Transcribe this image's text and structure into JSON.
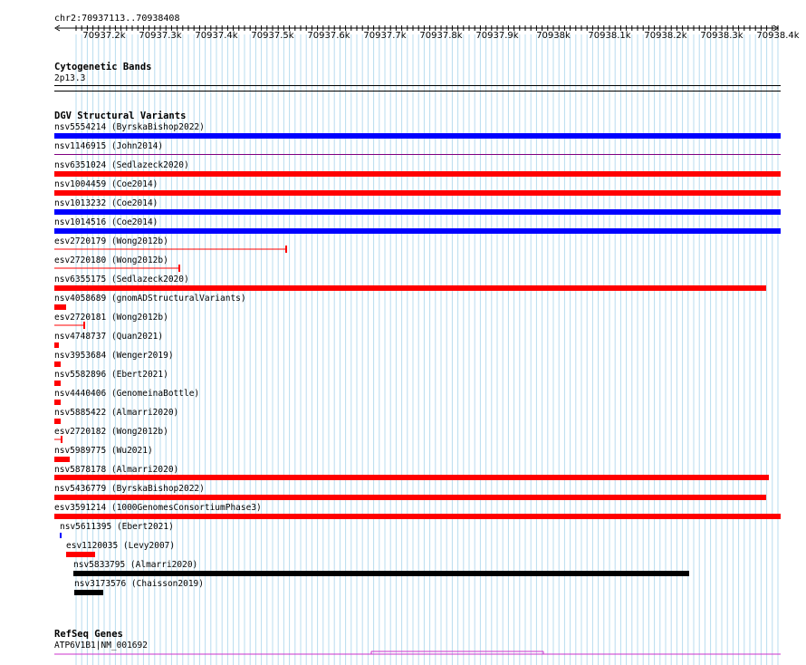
{
  "ruler": {
    "region": "chr2:70937113..70938408",
    "ticks": [
      "70937.2k",
      "70937.3k",
      "70937.4k",
      "70937.5k",
      "70937.6k",
      "70937.7k",
      "70937.8k",
      "70937.9k",
      "70938k",
      "70938.1k",
      "70938.2k",
      "70938.3k",
      "70938.4k"
    ]
  },
  "cytobands": {
    "title": "Cytogenetic Bands",
    "band": "2p13.3"
  },
  "dgv": {
    "title": "DGV Structural Variants",
    "features": [
      {
        "label": "nsv5554214 (ByrskaBishop2022)",
        "color": "#0000ff"
      },
      {
        "label": "nsv1146915 (John2014)",
        "color": "#800080"
      },
      {
        "label": "nsv6351024 (Sedlazeck2020)",
        "color": "#ff0000"
      },
      {
        "label": "nsv1004459 (Coe2014)",
        "color": "#ff0000"
      },
      {
        "label": "nsv1013232 (Coe2014)",
        "color": "#0000ff"
      },
      {
        "label": "nsv1014516 (Coe2014)",
        "color": "#0000ff"
      },
      {
        "label": "esv2720179 (Wong2012b)",
        "color": "#ff0000"
      },
      {
        "label": "esv2720180 (Wong2012b)",
        "color": "#ff0000"
      },
      {
        "label": "nsv6355175 (Sedlazeck2020)",
        "color": "#ff0000"
      },
      {
        "label": "nsv4058689 (gnomADStructuralVariants)",
        "color": "#ff0000"
      },
      {
        "label": "esv2720181 (Wong2012b)",
        "color": "#ff0000"
      },
      {
        "label": "nsv4748737 (Quan2021)",
        "color": "#ff0000"
      },
      {
        "label": "nsv3953684 (Wenger2019)",
        "color": "#ff0000"
      },
      {
        "label": "nsv5582896 (Ebert2021)",
        "color": "#ff0000"
      },
      {
        "label": "nsv4440406 (GenomeinaBottle)",
        "color": "#ff0000"
      },
      {
        "label": "nsv5885422 (Almarri2020)",
        "color": "#ff0000"
      },
      {
        "label": "esv2720182 (Wong2012b)",
        "color": "#ff0000"
      },
      {
        "label": "nsv5989775 (Wu2021)",
        "color": "#ff0000"
      },
      {
        "label": "nsv5878178 (Almarri2020)",
        "color": "#ff0000"
      },
      {
        "label": "nsv5436779 (ByrskaBishop2022)",
        "color": "#ff0000"
      },
      {
        "label": "esv3591214 (1000GenomesConsortiumPhase3)",
        "color": "#ff0000"
      },
      {
        "label": "nsv5611395 (Ebert2021)",
        "color": "#0000ff"
      },
      {
        "label": "esv1120035 (Levy2007)",
        "color": "#ff0000"
      },
      {
        "label": "nsv5833795 (Almarri2020)",
        "color": "#000000"
      },
      {
        "label": "nsv3173576 (Chaisson2019)",
        "color": "#000000"
      }
    ]
  },
  "refseq": {
    "title": "RefSeq Genes",
    "gene": "ATP6V1B1|NM_001692",
    "color": "#cc33cc"
  }
}
